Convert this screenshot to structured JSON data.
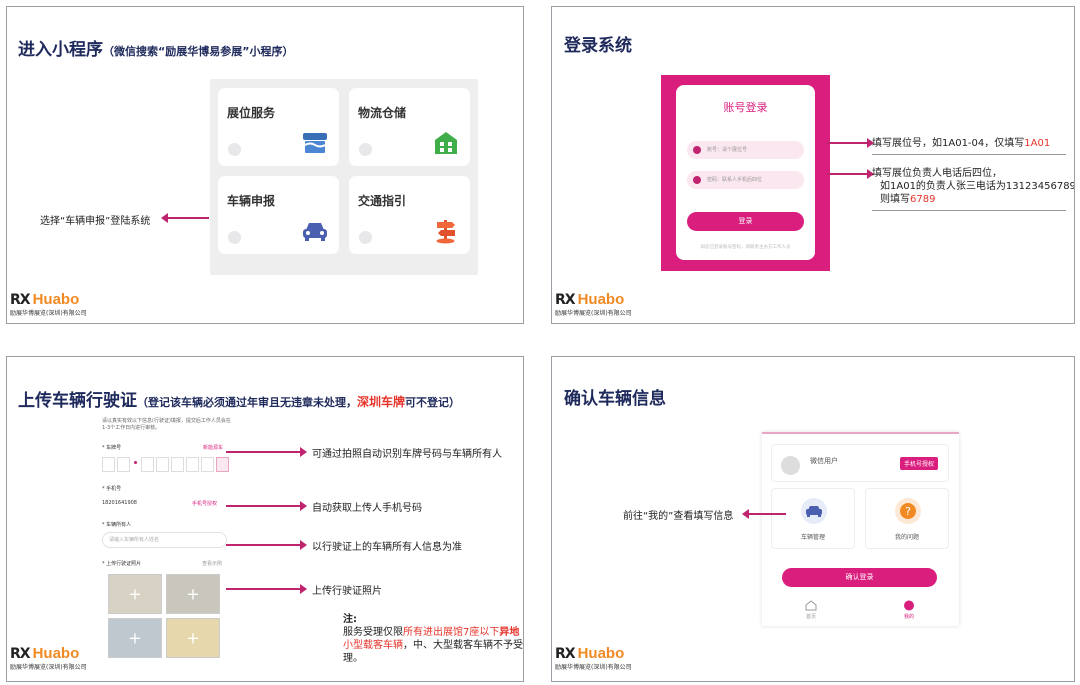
{
  "colors": {
    "accent": "#d91e7e",
    "title": "#1f2a5c",
    "highlight": "#e5332a",
    "logo_orange": "#f28a24"
  },
  "logo": {
    "mark": "RX",
    "brand": "Huabo",
    "company": "励展华博展览(深圳)有限公司"
  },
  "slide1": {
    "title": "进入小程序",
    "subtitle": "（微信搜索“励展华博易参展”小程序）",
    "menu": [
      {
        "label": "展位服务",
        "icon": "booth-icon"
      },
      {
        "label": "物流仓储",
        "icon": "warehouse-icon"
      },
      {
        "label": "车辆申报",
        "icon": "car-icon"
      },
      {
        "label": "交通指引",
        "icon": "signpost-icon"
      }
    ],
    "note": "选择“车辆申报”登陆系统"
  },
  "slide2": {
    "title": "登录系统",
    "login": {
      "heading": "账号登录",
      "account_placeholder": "账号：请个展位号",
      "password_placeholder": "密码：联系人手机后四位",
      "button": "登录",
      "footer": "如您已登录账号密码，请联系主办方工作人员"
    },
    "callout1_prefix": "填写展位号，如1A01-04，仅填写",
    "callout1_value": "1A01",
    "callout2_line1": "填写展位负责人电话后四位，",
    "callout2_line2": "如1A01的负责人张三电话为13123456789",
    "callout2_line3_prefix": "则填写",
    "callout2_line3_value": "6789"
  },
  "slide3": {
    "title": "上传车辆行驶证",
    "subtitle_a": "（登记该车辆必须",
    "subtitle_b": "通过年审且无违章未处理",
    "subtitle_c": "，",
    "subtitle_d": "深圳车牌",
    "subtitle_e": "可不登记",
    "subtitle_f": "）",
    "form": {
      "intro_1": "请以真实有效以下信息(行驶证)填报，提交后工作人员会在",
      "intro_2": "1-3个工作日内进行审核。",
      "plate_label": "* 车牌号",
      "plate_action": "新能源车",
      "phone_label": "* 手机号",
      "phone_value": "18201641908",
      "phone_action": "手机号授权",
      "owner_label": "* 车辆所有人",
      "owner_placeholder": "请输入车辆所有人姓名",
      "photo_label": "* 上传行驶证照片",
      "photo_action": "查看示例"
    },
    "notes": [
      "可通过拍照自动识别车牌号码与车辆所有人",
      "自动获取上传人手机号码",
      "以行驶证上的车辆所有人信息为准",
      "上传行驶证照片"
    ],
    "footnote": {
      "label": "注:",
      "t1": "服务受理仅限",
      "t2": "所有进出展馆7座以下",
      "t3": "异地",
      "t4": "小型载客车辆",
      "t5": "，中、大型载客车辆不予受",
      "t6": "理。"
    }
  },
  "slide4": {
    "title": "确认车辆信息",
    "profile": {
      "user": "微信用户",
      "badge": "手机号授权",
      "tile1": "车辆管理",
      "tile2": "我的问题",
      "button": "确认登录",
      "tab1": "首页",
      "tab2": "我的"
    },
    "note": "前往“我的”查看填写信息"
  }
}
